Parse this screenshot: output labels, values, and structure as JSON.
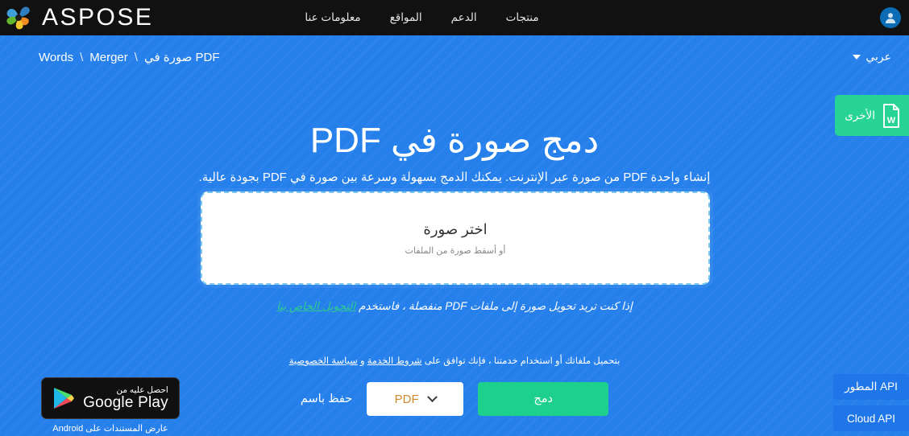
{
  "topbar": {
    "brand": "ASPOSE",
    "logo_icon": "aspose-swirl-logo",
    "nav": [
      {
        "label": "منتجات"
      },
      {
        "label": "الدعم"
      },
      {
        "label": "المواقع"
      },
      {
        "label": "معلومات عنا"
      }
    ],
    "account_icon": "user-avatar-icon"
  },
  "hero": {
    "language": {
      "label": "عربي",
      "caret_icon": "chevron-down-icon"
    },
    "breadcrumb": {
      "items": [
        "Words",
        "Merger",
        "صورة في PDF"
      ],
      "separator": "\\"
    },
    "title": "دمج صورة في PDF",
    "subtitle": "إنشاء واحدة PDF من صورة عبر الإنترنت. يمكنك الدمج بسهولة وسرعة بين صورة في PDF بجودة عالية.",
    "dropzone": {
      "title": "اختر صورة",
      "subtitle": "أو أسقط صورة من الملفات"
    },
    "helper": {
      "prefix": "إذا كنت تريد تحويل صورة إلى ملفات PDF منفصلة ، فاستخدم",
      "link": "التحويل الخاص بنا"
    },
    "privacy": {
      "prefix": "بتحميل ملفاتك أو استخدام خدمتنا ، فإنك توافق على",
      "link_terms": "شروط الخدمة",
      "and": "و",
      "link_privacy": "سياسة الخصوصية"
    },
    "actions": {
      "merge_label": "دمج",
      "format_value": "PDF",
      "format_caret_icon": "chevron-down-icon",
      "save_as_label": "حفظ باسم"
    },
    "google_play": {
      "small_text": "احصل عليه من",
      "big_text": "Google Play",
      "icon": "google-play-triangle-icon",
      "caption": "عارض المستندات على Android"
    },
    "other_tab": {
      "label": "الأخرى",
      "icon": "word-document-icon"
    },
    "api_buttons": [
      {
        "label": "API المطور"
      },
      {
        "label": "Cloud API"
      }
    ]
  },
  "colors": {
    "hero_blue": "#2680eb",
    "topbar_black": "#111111",
    "merge_green": "#1dd18c",
    "tab_green": "#27d496",
    "api_blue": "#1f76e8",
    "link_green": "#2ecc8f",
    "dashed_border": "#7ec8ef"
  }
}
